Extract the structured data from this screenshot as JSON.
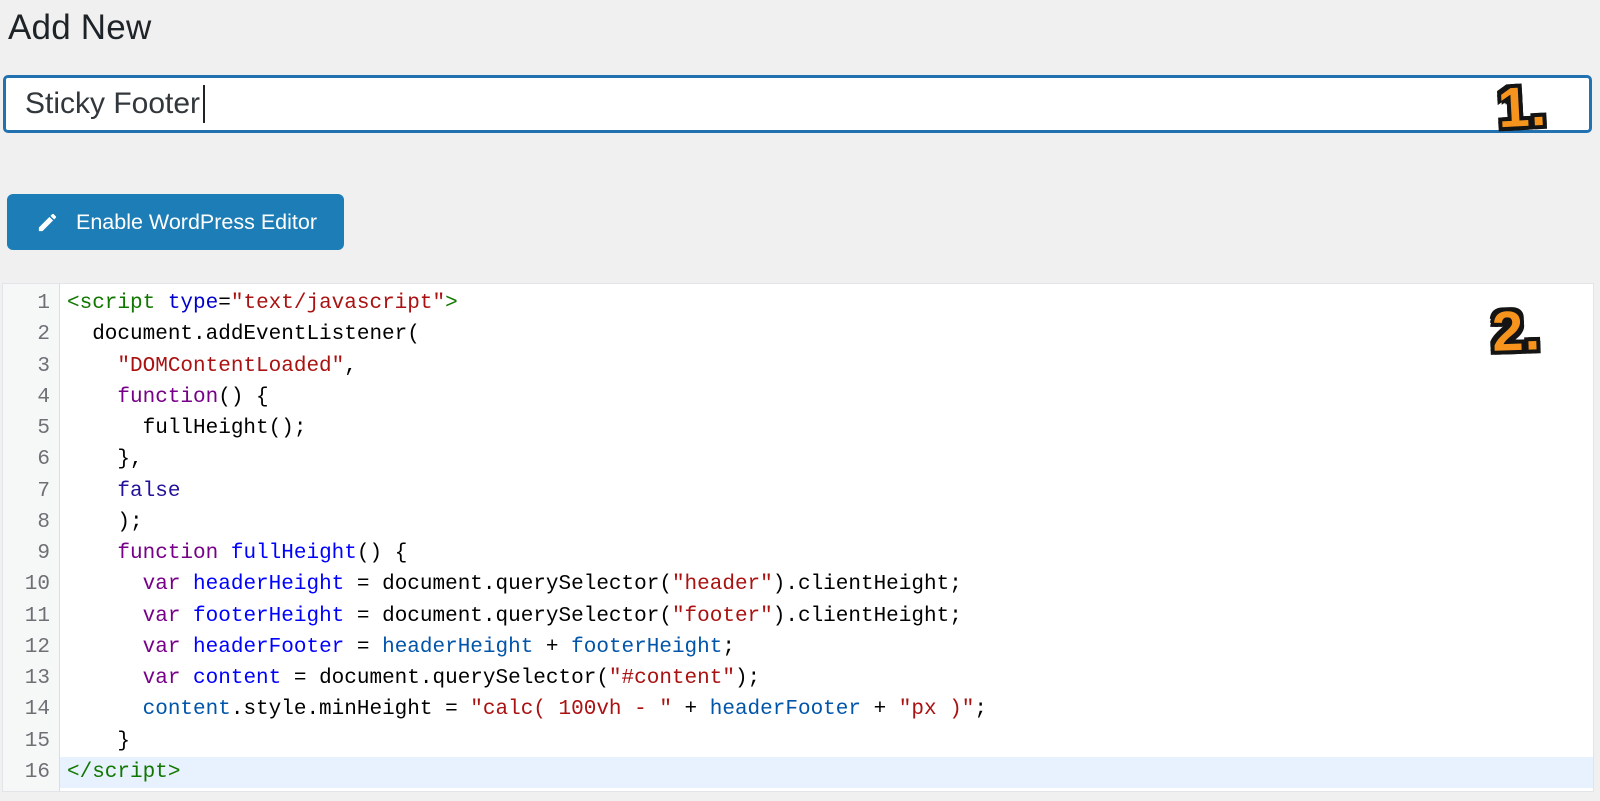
{
  "header": {
    "title": "Add New"
  },
  "title_field": {
    "value": "Sticky Footer",
    "placeholder": ""
  },
  "actions": {
    "enable_editor_label": "Enable WordPress Editor"
  },
  "annotations": [
    {
      "label": "1."
    },
    {
      "label": "2."
    }
  ],
  "colors": {
    "page_background": "#f0f0f1",
    "input_focus_border": "#2271b1",
    "button_blue": "#1d7db6",
    "annotation_orange": "#f7941d",
    "active_line_highlight": "#e8f2fe",
    "syntax_tag_green": "#117700",
    "syntax_attribute_blue": "#0000cc",
    "syntax_string_red": "#aa1111",
    "syntax_keyword_purple": "#770088",
    "syntax_definition_blue": "#0000ff",
    "syntax_variable_blue": "#0055aa",
    "syntax_atom_blue": "#221199"
  },
  "editor": {
    "active_line": 16,
    "lines": [
      {
        "num": 1,
        "tokens": [
          {
            "t": "<script",
            "c": "tag"
          },
          {
            "t": " ",
            "c": "plain"
          },
          {
            "t": "type",
            "c": "attr"
          },
          {
            "t": "=",
            "c": "plain"
          },
          {
            "t": "\"text/javascript\"",
            "c": "str"
          },
          {
            "t": ">",
            "c": "tag"
          }
        ]
      },
      {
        "num": 2,
        "tokens": [
          {
            "t": "  document.addEventListener(",
            "c": "plain"
          }
        ]
      },
      {
        "num": 3,
        "tokens": [
          {
            "t": "    ",
            "c": "plain"
          },
          {
            "t": "\"DOMContentLoaded\"",
            "c": "str"
          },
          {
            "t": ",",
            "c": "plain"
          }
        ]
      },
      {
        "num": 4,
        "tokens": [
          {
            "t": "    ",
            "c": "plain"
          },
          {
            "t": "function",
            "c": "kw"
          },
          {
            "t": "() {",
            "c": "plain"
          }
        ]
      },
      {
        "num": 5,
        "tokens": [
          {
            "t": "      fullHeight();",
            "c": "plain"
          }
        ]
      },
      {
        "num": 6,
        "tokens": [
          {
            "t": "    },",
            "c": "plain"
          }
        ]
      },
      {
        "num": 7,
        "tokens": [
          {
            "t": "    ",
            "c": "plain"
          },
          {
            "t": "false",
            "c": "atom"
          }
        ]
      },
      {
        "num": 8,
        "tokens": [
          {
            "t": "    );",
            "c": "plain"
          }
        ]
      },
      {
        "num": 9,
        "tokens": [
          {
            "t": "    ",
            "c": "plain"
          },
          {
            "t": "function",
            "c": "kw"
          },
          {
            "t": " ",
            "c": "plain"
          },
          {
            "t": "fullHeight",
            "c": "def"
          },
          {
            "t": "() {",
            "c": "plain"
          }
        ]
      },
      {
        "num": 10,
        "tokens": [
          {
            "t": "      ",
            "c": "plain"
          },
          {
            "t": "var",
            "c": "kw"
          },
          {
            "t": " ",
            "c": "plain"
          },
          {
            "t": "headerHeight",
            "c": "def"
          },
          {
            "t": " = document.querySelector(",
            "c": "plain"
          },
          {
            "t": "\"header\"",
            "c": "str"
          },
          {
            "t": ").clientHeight;",
            "c": "plain"
          }
        ]
      },
      {
        "num": 11,
        "tokens": [
          {
            "t": "      ",
            "c": "plain"
          },
          {
            "t": "var",
            "c": "kw"
          },
          {
            "t": " ",
            "c": "plain"
          },
          {
            "t": "footerHeight",
            "c": "def"
          },
          {
            "t": " = document.querySelector(",
            "c": "plain"
          },
          {
            "t": "\"footer\"",
            "c": "str"
          },
          {
            "t": ").clientHeight;",
            "c": "plain"
          }
        ]
      },
      {
        "num": 12,
        "tokens": [
          {
            "t": "      ",
            "c": "plain"
          },
          {
            "t": "var",
            "c": "kw"
          },
          {
            "t": " ",
            "c": "plain"
          },
          {
            "t": "headerFooter",
            "c": "def"
          },
          {
            "t": " = ",
            "c": "plain"
          },
          {
            "t": "headerHeight",
            "c": "var2"
          },
          {
            "t": " + ",
            "c": "plain"
          },
          {
            "t": "footerHeight",
            "c": "var2"
          },
          {
            "t": ";",
            "c": "plain"
          }
        ]
      },
      {
        "num": 13,
        "tokens": [
          {
            "t": "      ",
            "c": "plain"
          },
          {
            "t": "var",
            "c": "kw"
          },
          {
            "t": " ",
            "c": "plain"
          },
          {
            "t": "content",
            "c": "def"
          },
          {
            "t": " = document.querySelector(",
            "c": "plain"
          },
          {
            "t": "\"#content\"",
            "c": "str"
          },
          {
            "t": ");",
            "c": "plain"
          }
        ]
      },
      {
        "num": 14,
        "tokens": [
          {
            "t": "      ",
            "c": "plain"
          },
          {
            "t": "content",
            "c": "var2"
          },
          {
            "t": ".style.minHeight = ",
            "c": "plain"
          },
          {
            "t": "\"calc( 100vh - \"",
            "c": "str"
          },
          {
            "t": " + ",
            "c": "plain"
          },
          {
            "t": "headerFooter",
            "c": "var2"
          },
          {
            "t": " + ",
            "c": "plain"
          },
          {
            "t": "\"px )\"",
            "c": "str"
          },
          {
            "t": ";",
            "c": "plain"
          }
        ]
      },
      {
        "num": 15,
        "tokens": [
          {
            "t": "    }",
            "c": "plain"
          }
        ]
      },
      {
        "num": 16,
        "tokens": [
          {
            "t": "</script",
            "c": "tag"
          },
          {
            "t": ">",
            "c": "tag"
          }
        ]
      }
    ]
  }
}
